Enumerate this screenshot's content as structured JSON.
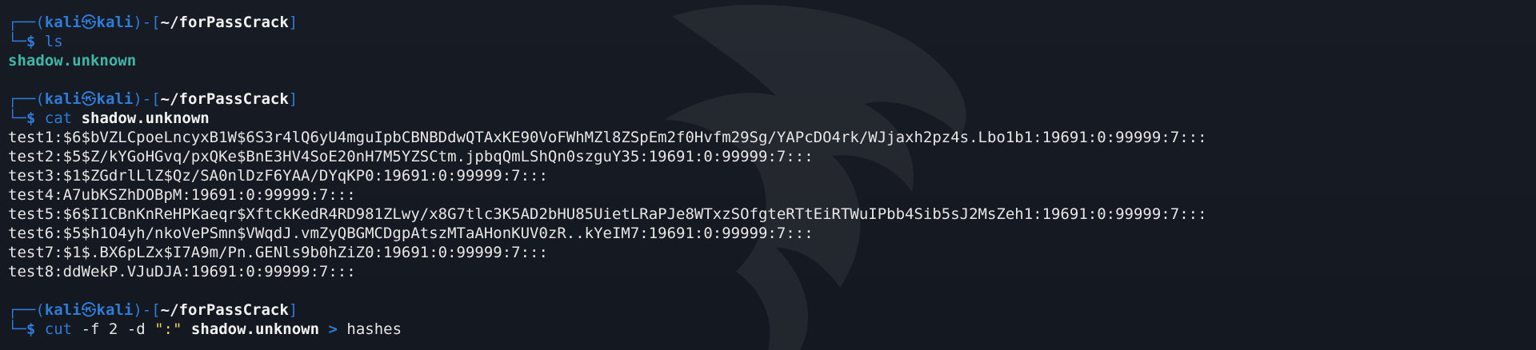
{
  "prompt": {
    "user": "kali",
    "host": "kali",
    "path": "~/forPassCrack"
  },
  "commands": [
    {
      "cmd": "ls",
      "args": []
    },
    {
      "cmd": "cat",
      "args": [
        "shadow.unknown"
      ]
    },
    {
      "cmd": "cut",
      "args": [
        "-f 2 -d",
        "\":\"",
        "shadow.unknown",
        ">",
        "hashes"
      ]
    }
  ],
  "ls_output": "shadow.unknown",
  "shadow_lines": [
    "test1:$6$bVZLCpoeLncyxB1W$6S3r4lQ6yU4mguIpbCBNBDdwQTAxKE90VoFWhMZl8ZSpEm2f0Hvfm29Sg/YAPcDO4rk/WJjaxh2pz4s.Lbo1b1:19691:0:99999:7:::",
    "test2:$5$Z/kYGoHGvq/pxQKe$BnE3HV4SoE20nH7M5YZSCtm.jpbqQmLShQn0szguY35:19691:0:99999:7:::",
    "test3:$1$ZGdrlLlZ$Qz/SA0nlDzF6YAA/DYqKP0:19691:0:99999:7:::",
    "test4:A7ubKSZhDOBpM:19691:0:99999:7:::",
    "test5:$6$I1CBnKnReHPKaeqr$XftckKedR4RD981ZLwy/x8G7tlc3K5AD2bHU85UietLRaPJe8WTxzSOfgteRTtEiRTWuIPbb4Sib5sJ2MsZeh1:19691:0:99999:7:::",
    "test6:$5$h1O4yh/nkoVePSmn$VWqdJ.vmZyQBGMCDgpAtszMTaAHonKUV0zR..kYeIM7:19691:0:99999:7:::",
    "test7:$1$.BX6pLZx$I7A9m/Pn.GENls9b0hZiZ0:19691:0:99999:7:::",
    "test8:ddWekP.VJuDJA:19691:0:99999:7:::"
  ],
  "colors": {
    "background": "#15181f",
    "prompt_blue": "#2f7bd8",
    "file_teal": "#3fb6a8",
    "string_yellow": "#e4d35c",
    "text": "#e6e6e6"
  }
}
